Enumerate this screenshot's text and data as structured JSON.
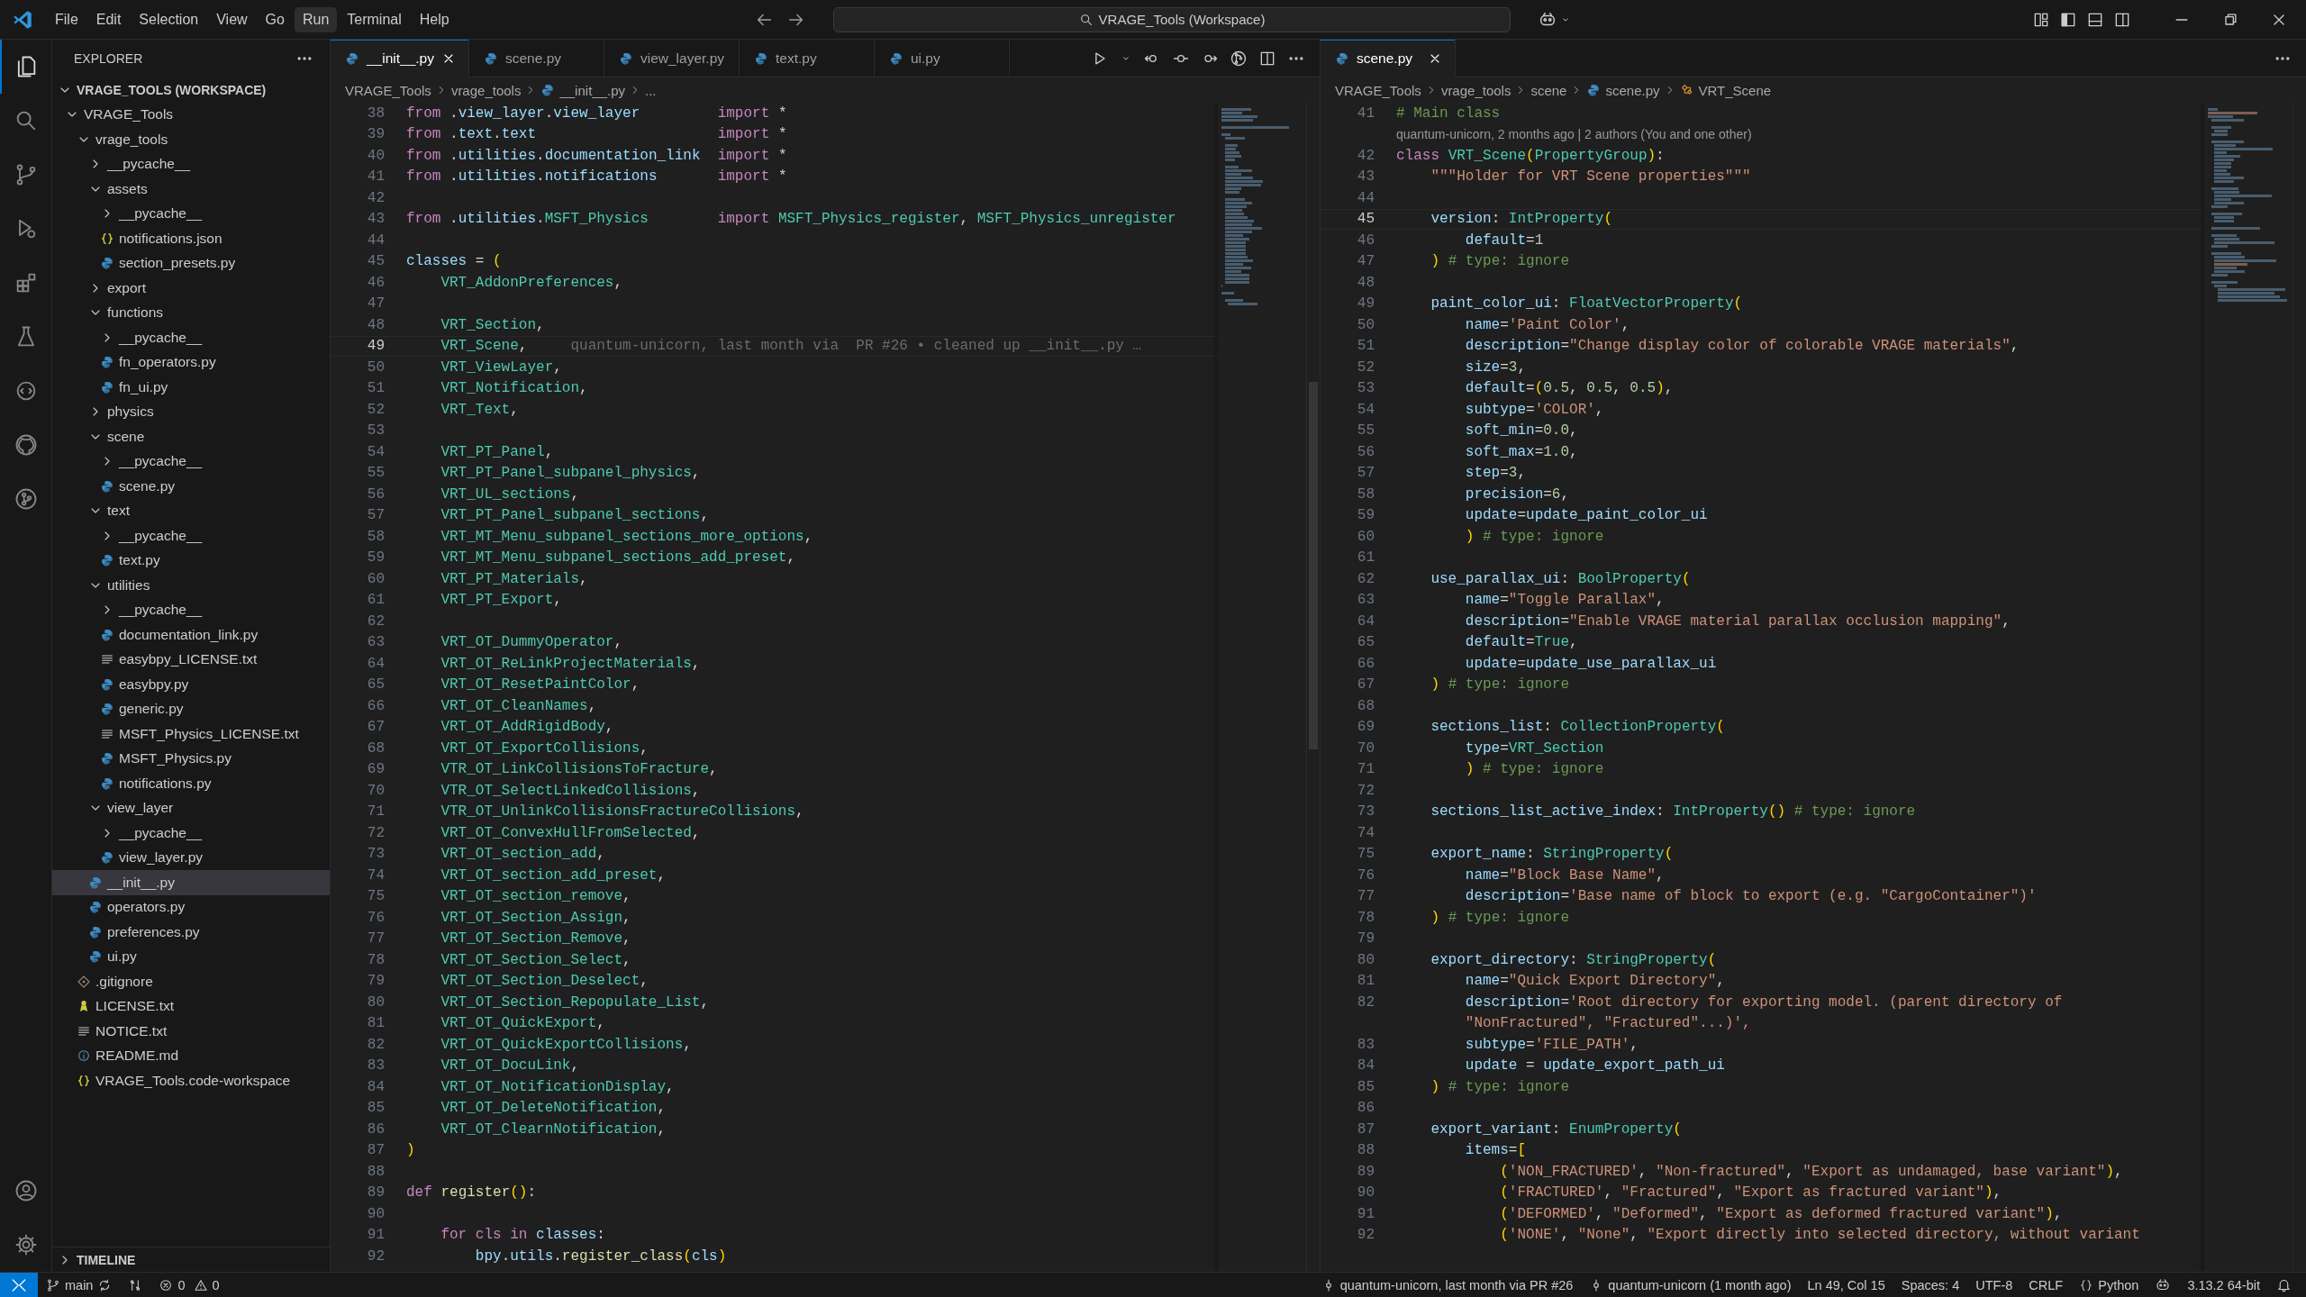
{
  "menu": [
    {
      "label": "File",
      "selected": false
    },
    {
      "label": "Edit",
      "selected": false
    },
    {
      "label": "Selection",
      "selected": false
    },
    {
      "label": "View",
      "selected": false
    },
    {
      "label": "Go",
      "selected": false
    },
    {
      "label": "Run",
      "selected": true
    },
    {
      "label": "Terminal",
      "selected": false
    },
    {
      "label": "Help",
      "selected": false
    }
  ],
  "command_center": {
    "text": "VRAGE_Tools (Workspace)"
  },
  "explorer": {
    "title": "EXPLORER",
    "workspace": {
      "label": "VRAGE_TOOLS (WORKSPACE)",
      "expanded": true
    },
    "timeline": {
      "label": "TIMELINE",
      "expanded": false
    },
    "tree": [
      {
        "label": "VRAGE_Tools",
        "kind": "folder",
        "expanded": true,
        "selected": false,
        "children": [
          {
            "label": "vrage_tools",
            "kind": "folder",
            "expanded": true,
            "selected": false,
            "children": [
              {
                "label": "__pycache__",
                "kind": "folder",
                "expanded": false,
                "selected": false
              },
              {
                "label": "assets",
                "kind": "folder",
                "expanded": true,
                "selected": false,
                "children": [
                  {
                    "label": "__pycache__",
                    "kind": "folder",
                    "expanded": false,
                    "selected": false
                  },
                  {
                    "label": "notifications.json",
                    "kind": "json",
                    "selected": false
                  },
                  {
                    "label": "section_presets.py",
                    "kind": "python",
                    "selected": false
                  }
                ]
              },
              {
                "label": "export",
                "kind": "folder",
                "expanded": false,
                "selected": false
              },
              {
                "label": "functions",
                "kind": "folder",
                "expanded": true,
                "selected": false,
                "children": [
                  {
                    "label": "__pycache__",
                    "kind": "folder",
                    "expanded": false,
                    "selected": false
                  },
                  {
                    "label": "fn_operators.py",
                    "kind": "python",
                    "selected": false
                  },
                  {
                    "label": "fn_ui.py",
                    "kind": "python",
                    "selected": false
                  }
                ]
              },
              {
                "label": "physics",
                "kind": "folder",
                "expanded": false,
                "selected": false
              },
              {
                "label": "scene",
                "kind": "folder",
                "expanded": true,
                "selected": false,
                "children": [
                  {
                    "label": "__pycache__",
                    "kind": "folder",
                    "expanded": false,
                    "selected": false
                  },
                  {
                    "label": "scene.py",
                    "kind": "python",
                    "selected": false
                  }
                ]
              },
              {
                "label": "text",
                "kind": "folder",
                "expanded": true,
                "selected": false,
                "children": [
                  {
                    "label": "__pycache__",
                    "kind": "folder",
                    "expanded": false,
                    "selected": false
                  },
                  {
                    "label": "text.py",
                    "kind": "python",
                    "selected": false
                  }
                ]
              },
              {
                "label": "utilities",
                "kind": "folder",
                "expanded": true,
                "selected": false,
                "children": [
                  {
                    "label": "__pycache__",
                    "kind": "folder",
                    "expanded": false,
                    "selected": false
                  },
                  {
                    "label": "documentation_link.py",
                    "kind": "python",
                    "selected": false
                  },
                  {
                    "label": "easybpy_LICENSE.txt",
                    "kind": "text",
                    "selected": false
                  },
                  {
                    "label": "easybpy.py",
                    "kind": "python",
                    "selected": false
                  },
                  {
                    "label": "generic.py",
                    "kind": "python",
                    "selected": false
                  },
                  {
                    "label": "MSFT_Physics_LICENSE.txt",
                    "kind": "text",
                    "selected": false
                  },
                  {
                    "label": "MSFT_Physics.py",
                    "kind": "python",
                    "selected": false
                  },
                  {
                    "label": "notifications.py",
                    "kind": "python",
                    "selected": false
                  }
                ]
              },
              {
                "label": "view_layer",
                "kind": "folder",
                "expanded": true,
                "selected": false,
                "children": [
                  {
                    "label": "__pycache__",
                    "kind": "folder",
                    "expanded": false,
                    "selected": false
                  },
                  {
                    "label": "view_layer.py",
                    "kind": "python",
                    "selected": false
                  }
                ]
              },
              {
                "label": "__init__.py",
                "kind": "python",
                "selected": true
              },
              {
                "label": "operators.py",
                "kind": "python",
                "selected": false
              },
              {
                "label": "preferences.py",
                "kind": "python",
                "selected": false
              },
              {
                "label": "ui.py",
                "kind": "python",
                "selected": false
              }
            ]
          },
          {
            "label": ".gitignore",
            "kind": "git",
            "selected": false
          },
          {
            "label": "LICENSE.txt",
            "kind": "license",
            "selected": false
          },
          {
            "label": "NOTICE.txt",
            "kind": "text",
            "selected": false
          },
          {
            "label": "README.md",
            "kind": "info",
            "selected": false
          },
          {
            "label": "VRAGE_Tools.code-workspace",
            "kind": "workspace",
            "selected": false
          }
        ]
      }
    ]
  },
  "editors": [
    {
      "tabs": [
        {
          "label": "__init__.py",
          "selected": true
        },
        {
          "label": "scene.py",
          "selected": false
        },
        {
          "label": "view_layer.py",
          "selected": false
        },
        {
          "label": "text.py",
          "selected": false
        },
        {
          "label": "ui.py",
          "selected": false
        }
      ],
      "breadcrumbs": [
        {
          "label": "VRAGE_Tools",
          "kind": "folder"
        },
        {
          "label": "vrage_tools",
          "kind": "folder"
        },
        {
          "label": "__init__.py",
          "kind": "python"
        },
        {
          "label": "...",
          "kind": "more"
        }
      ],
      "lines": [
        {
          "kind": "code",
          "n": "38",
          "parts": [
            "from .view_layer.view_layer",
            "import *"
          ],
          "active": false
        },
        {
          "kind": "code",
          "n": "39",
          "parts": [
            "from .text.text",
            "import *"
          ],
          "active": false
        },
        {
          "kind": "code",
          "n": "40",
          "parts": [
            "from .utilities.documentation_link",
            "import *"
          ],
          "active": false
        },
        {
          "kind": "code",
          "n": "41",
          "parts": [
            "from .utilities.notifications",
            "import *"
          ],
          "active": false
        },
        {
          "kind": "code",
          "n": "42",
          "active": false
        },
        {
          "kind": "code",
          "n": "43",
          "parts": [
            "from .utilities.MSFT_Physics",
            "import MSFT_Physics_register, MSFT_Physics_unregister"
          ],
          "active": false
        },
        {
          "kind": "code",
          "n": "44",
          "active": false
        },
        {
          "kind": "code",
          "n": "45",
          "code": "classes = (",
          "active": false
        },
        {
          "kind": "code",
          "n": "46",
          "code": "    VRT_AddonPreferences,",
          "active": false
        },
        {
          "kind": "code",
          "n": "47",
          "active": false
        },
        {
          "kind": "code",
          "n": "48",
          "code": "    VRT_Section,",
          "active": false
        },
        {
          "kind": "code",
          "n": "49",
          "code": "    VRT_Scene,",
          "active": true,
          "blame": "quantum-unicorn, last month via  PR #26 • cleaned up __init__.py …"
        },
        {
          "kind": "code",
          "n": "50",
          "code": "    VRT_ViewLayer,",
          "active": false
        },
        {
          "kind": "code",
          "n": "51",
          "code": "    VRT_Notification,",
          "active": false
        },
        {
          "kind": "code",
          "n": "52",
          "code": "    VRT_Text,",
          "active": false
        },
        {
          "kind": "code",
          "n": "53",
          "active": false
        },
        {
          "kind": "code",
          "n": "54",
          "code": "    VRT_PT_Panel,",
          "active": false
        },
        {
          "kind": "code",
          "n": "55",
          "code": "    VRT_PT_Panel_subpanel_physics,",
          "active": false
        },
        {
          "kind": "code",
          "n": "56",
          "code": "    VRT_UL_sections,",
          "active": false
        },
        {
          "kind": "code",
          "n": "57",
          "code": "    VRT_PT_Panel_subpanel_sections,",
          "active": false
        },
        {
          "kind": "code",
          "n": "58",
          "code": "    VRT_MT_Menu_subpanel_sections_more_options,",
          "active": false
        },
        {
          "kind": "code",
          "n": "59",
          "code": "    VRT_MT_Menu_subpanel_sections_add_preset,",
          "active": false
        },
        {
          "kind": "code",
          "n": "60",
          "code": "    VRT_PT_Materials,",
          "active": false
        },
        {
          "kind": "code",
          "n": "61",
          "code": "    VRT_PT_Export,",
          "active": false
        },
        {
          "kind": "code",
          "n": "62",
          "active": false
        },
        {
          "kind": "code",
          "n": "63",
          "code": "    VRT_OT_DummyOperator,",
          "active": false
        },
        {
          "kind": "code",
          "n": "64",
          "code": "    VRT_OT_ReLinkProjectMaterials,",
          "active": false
        },
        {
          "kind": "code",
          "n": "65",
          "code": "    VRT_OT_ResetPaintColor,",
          "active": false
        },
        {
          "kind": "code",
          "n": "66",
          "code": "    VRT_OT_CleanNames,",
          "active": false
        },
        {
          "kind": "code",
          "n": "67",
          "code": "    VRT_OT_AddRigidBody,",
          "active": false
        },
        {
          "kind": "code",
          "n": "68",
          "code": "    VRT_OT_ExportCollisions,",
          "active": false
        },
        {
          "kind": "code",
          "n": "69",
          "code": "    VTR_OT_LinkCollisionsToFracture,",
          "active": false
        },
        {
          "kind": "code",
          "n": "70",
          "code": "    VTR_OT_SelectLinkedCollisions,",
          "active": false
        },
        {
          "kind": "code",
          "n": "71",
          "code": "    VTR_OT_UnlinkCollisionsFractureCollisions,",
          "active": false
        },
        {
          "kind": "code",
          "n": "72",
          "code": "    VRT_OT_ConvexHullFromSelected,",
          "active": false
        },
        {
          "kind": "code",
          "n": "73",
          "code": "    VRT_OT_section_add,",
          "active": false
        },
        {
          "kind": "code",
          "n": "74",
          "code": "    VRT_OT_section_add_preset,",
          "active": false
        },
        {
          "kind": "code",
          "n": "75",
          "code": "    VRT_OT_section_remove,",
          "active": false
        },
        {
          "kind": "code",
          "n": "76",
          "code": "    VRT_OT_Section_Assign,",
          "active": false
        },
        {
          "kind": "code",
          "n": "77",
          "code": "    VRT_OT_Section_Remove,",
          "active": false
        },
        {
          "kind": "code",
          "n": "78",
          "code": "    VRT_OT_Section_Select,",
          "active": false
        },
        {
          "kind": "code",
          "n": "79",
          "code": "    VRT_OT_Section_Deselect,",
          "active": false
        },
        {
          "kind": "code",
          "n": "80",
          "code": "    VRT_OT_Section_Repopulate_List,",
          "active": false
        },
        {
          "kind": "code",
          "n": "81",
          "code": "    VRT_OT_QuickExport,",
          "active": false
        },
        {
          "kind": "code",
          "n": "82",
          "code": "    VRT_OT_QuickExportCollisions,",
          "active": false
        },
        {
          "kind": "code",
          "n": "83",
          "code": "    VRT_OT_DocuLink,",
          "active": false
        },
        {
          "kind": "code",
          "n": "84",
          "code": "    VRT_OT_NotificationDisplay,",
          "active": false
        },
        {
          "kind": "code",
          "n": "85",
          "code": "    VRT_OT_DeleteNotification,",
          "active": false
        },
        {
          "kind": "code",
          "n": "86",
          "code": "    VRT_OT_ClearnNotification,",
          "active": false
        },
        {
          "kind": "code",
          "n": "87",
          "code": ")",
          "active": false
        },
        {
          "kind": "code",
          "n": "88",
          "active": false
        },
        {
          "kind": "code",
          "n": "89",
          "code": "def register():",
          "active": false
        },
        {
          "kind": "code",
          "n": "90",
          "active": false
        },
        {
          "kind": "code",
          "n": "91",
          "code": "    for cls in classes:",
          "active": false
        },
        {
          "kind": "code",
          "n": "92",
          "code": "        bpy.utils.register_class(cls)",
          "active": false
        }
      ]
    },
    {
      "tabs": [
        {
          "label": "scene.py",
          "selected": true
        }
      ],
      "breadcrumbs": [
        {
          "label": "VRAGE_Tools",
          "kind": "folder"
        },
        {
          "label": "vrage_tools",
          "kind": "folder"
        },
        {
          "label": "scene",
          "kind": "folder"
        },
        {
          "label": "scene.py",
          "kind": "python"
        },
        {
          "label": "VRT_Scene",
          "kind": "symbol"
        }
      ],
      "lines": [
        {
          "kind": "code",
          "n": "41",
          "code": "# Main class",
          "active": false
        },
        {
          "kind": "lens",
          "code": "quantum-unicorn, 2 months ago | 2 authors (You and one other)"
        },
        {
          "kind": "code",
          "n": "42",
          "code": "class VRT_Scene(PropertyGroup):",
          "active": false
        },
        {
          "kind": "code",
          "n": "43",
          "code": "    \"\"\"Holder for VRT Scene properties\"\"\"",
          "active": false
        },
        {
          "kind": "code",
          "n": "44",
          "active": false
        },
        {
          "kind": "code",
          "n": "45",
          "code": "    version: IntProperty(",
          "active": true
        },
        {
          "kind": "code",
          "n": "46",
          "code": "        default=1",
          "active": false
        },
        {
          "kind": "code",
          "n": "47",
          "code": "    ) # type: ignore",
          "active": false
        },
        {
          "kind": "code",
          "n": "48",
          "active": false
        },
        {
          "kind": "code",
          "n": "49",
          "code": "    paint_color_ui: FloatVectorProperty(",
          "active": false
        },
        {
          "kind": "code",
          "n": "50",
          "code": "        name='Paint Color',",
          "active": false
        },
        {
          "kind": "code",
          "n": "51",
          "code": "        description=\"Change display color of colorable VRAGE materials\",",
          "active": false
        },
        {
          "kind": "code",
          "n": "52",
          "code": "        size=3,",
          "active": false
        },
        {
          "kind": "code",
          "n": "53",
          "code": "        default=(0.5, 0.5, 0.5),",
          "active": false
        },
        {
          "kind": "code",
          "n": "54",
          "code": "        subtype='COLOR',",
          "active": false
        },
        {
          "kind": "code",
          "n": "55",
          "code": "        soft_min=0.0,",
          "active": false
        },
        {
          "kind": "code",
          "n": "56",
          "code": "        soft_max=1.0,",
          "active": false
        },
        {
          "kind": "code",
          "n": "57",
          "code": "        step=3,",
          "active": false
        },
        {
          "kind": "code",
          "n": "58",
          "code": "        precision=6,",
          "active": false
        },
        {
          "kind": "code",
          "n": "59",
          "code": "        update=update_paint_color_ui",
          "active": false
        },
        {
          "kind": "code",
          "n": "60",
          "code": "        ) # type: ignore",
          "active": false
        },
        {
          "kind": "code",
          "n": "61",
          "active": false
        },
        {
          "kind": "code",
          "n": "62",
          "code": "    use_parallax_ui: BoolProperty(",
          "active": false
        },
        {
          "kind": "code",
          "n": "63",
          "code": "        name=\"Toggle Parallax\",",
          "active": false
        },
        {
          "kind": "code",
          "n": "64",
          "code": "        description=\"Enable VRAGE material parallax occlusion mapping\",",
          "active": false
        },
        {
          "kind": "code",
          "n": "65",
          "code": "        default=True,",
          "active": false
        },
        {
          "kind": "code",
          "n": "66",
          "code": "        update=update_use_parallax_ui",
          "active": false
        },
        {
          "kind": "code",
          "n": "67",
          "code": "    ) # type: ignore",
          "active": false
        },
        {
          "kind": "code",
          "n": "68",
          "active": false
        },
        {
          "kind": "code",
          "n": "69",
          "code": "    sections_list: CollectionProperty(",
          "active": false
        },
        {
          "kind": "code",
          "n": "70",
          "code": "        type=VRT_Section",
          "active": false
        },
        {
          "kind": "code",
          "n": "71",
          "code": "        ) # type: ignore",
          "active": false
        },
        {
          "kind": "code",
          "n": "72",
          "active": false
        },
        {
          "kind": "code",
          "n": "73",
          "code": "    sections_list_active_index: IntProperty() # type: ignore",
          "active": false
        },
        {
          "kind": "code",
          "n": "74",
          "active": false
        },
        {
          "kind": "code",
          "n": "75",
          "code": "    export_name: StringProperty(",
          "active": false
        },
        {
          "kind": "code",
          "n": "76",
          "code": "        name=\"Block Base Name\",",
          "active": false
        },
        {
          "kind": "code",
          "n": "77",
          "code": "        description='Base name of block to export (e.g. \"CargoContainer\")'",
          "active": false
        },
        {
          "kind": "code",
          "n": "78",
          "code": "    ) # type: ignore",
          "active": false
        },
        {
          "kind": "code",
          "n": "79",
          "active": false
        },
        {
          "kind": "code",
          "n": "80",
          "code": "    export_directory: StringProperty(",
          "active": false
        },
        {
          "kind": "code",
          "n": "81",
          "code": "        name=\"Quick Export Directory\",",
          "active": false
        },
        {
          "kind": "code",
          "n": "82",
          "code": "        description='Root directory for exporting model. (parent directory of",
          "active": false
        },
        {
          "kind": "wrap",
          "code": "        \"NonFractured\", \"Fractured\"...)',"
        },
        {
          "kind": "code",
          "n": "83",
          "code": "        subtype='FILE_PATH',",
          "active": false
        },
        {
          "kind": "code",
          "n": "84",
          "code": "        update = update_export_path_ui",
          "active": false
        },
        {
          "kind": "code",
          "n": "85",
          "code": "    ) # type: ignore",
          "active": false
        },
        {
          "kind": "code",
          "n": "86",
          "active": false
        },
        {
          "kind": "code",
          "n": "87",
          "code": "    export_variant: EnumProperty(",
          "active": false
        },
        {
          "kind": "code",
          "n": "88",
          "code": "        items=[",
          "active": false
        },
        {
          "kind": "code",
          "n": "89",
          "code": "            ('NON_FRACTURED', \"Non-fractured\", \"Export as undamaged, base variant\"),",
          "active": false
        },
        {
          "kind": "code",
          "n": "90",
          "code": "            ('FRACTURED', \"Fractured\", \"Export as fractured variant\"),",
          "active": false
        },
        {
          "kind": "code",
          "n": "91",
          "code": "            ('DEFORMED', \"Deformed\", \"Export as deformed fractured variant\"),",
          "active": false
        },
        {
          "kind": "code",
          "n": "92",
          "code": "            ('NONE', \"None\", \"Export directly into selected directory, without variant",
          "active": false
        }
      ]
    }
  ],
  "status_bar": {
    "branch": "main",
    "errors": "0",
    "warnings": "0",
    "items": [
      {
        "kind": "commit",
        "text": "quantum-unicorn, last month via  PR #26"
      },
      {
        "kind": "commit",
        "text": "quantum-unicorn (1 month ago)"
      },
      {
        "kind": "plain",
        "text": "Ln 49, Col 15"
      },
      {
        "kind": "plain",
        "text": "Spaces: 4"
      },
      {
        "kind": "plain",
        "text": "UTF-8"
      },
      {
        "kind": "plain",
        "text": "CRLF"
      },
      {
        "kind": "language",
        "text": "Python"
      },
      {
        "kind": "copilot"
      },
      {
        "kind": "plain",
        "text": "3.13.2 64-bit"
      },
      {
        "kind": "bell"
      }
    ]
  }
}
